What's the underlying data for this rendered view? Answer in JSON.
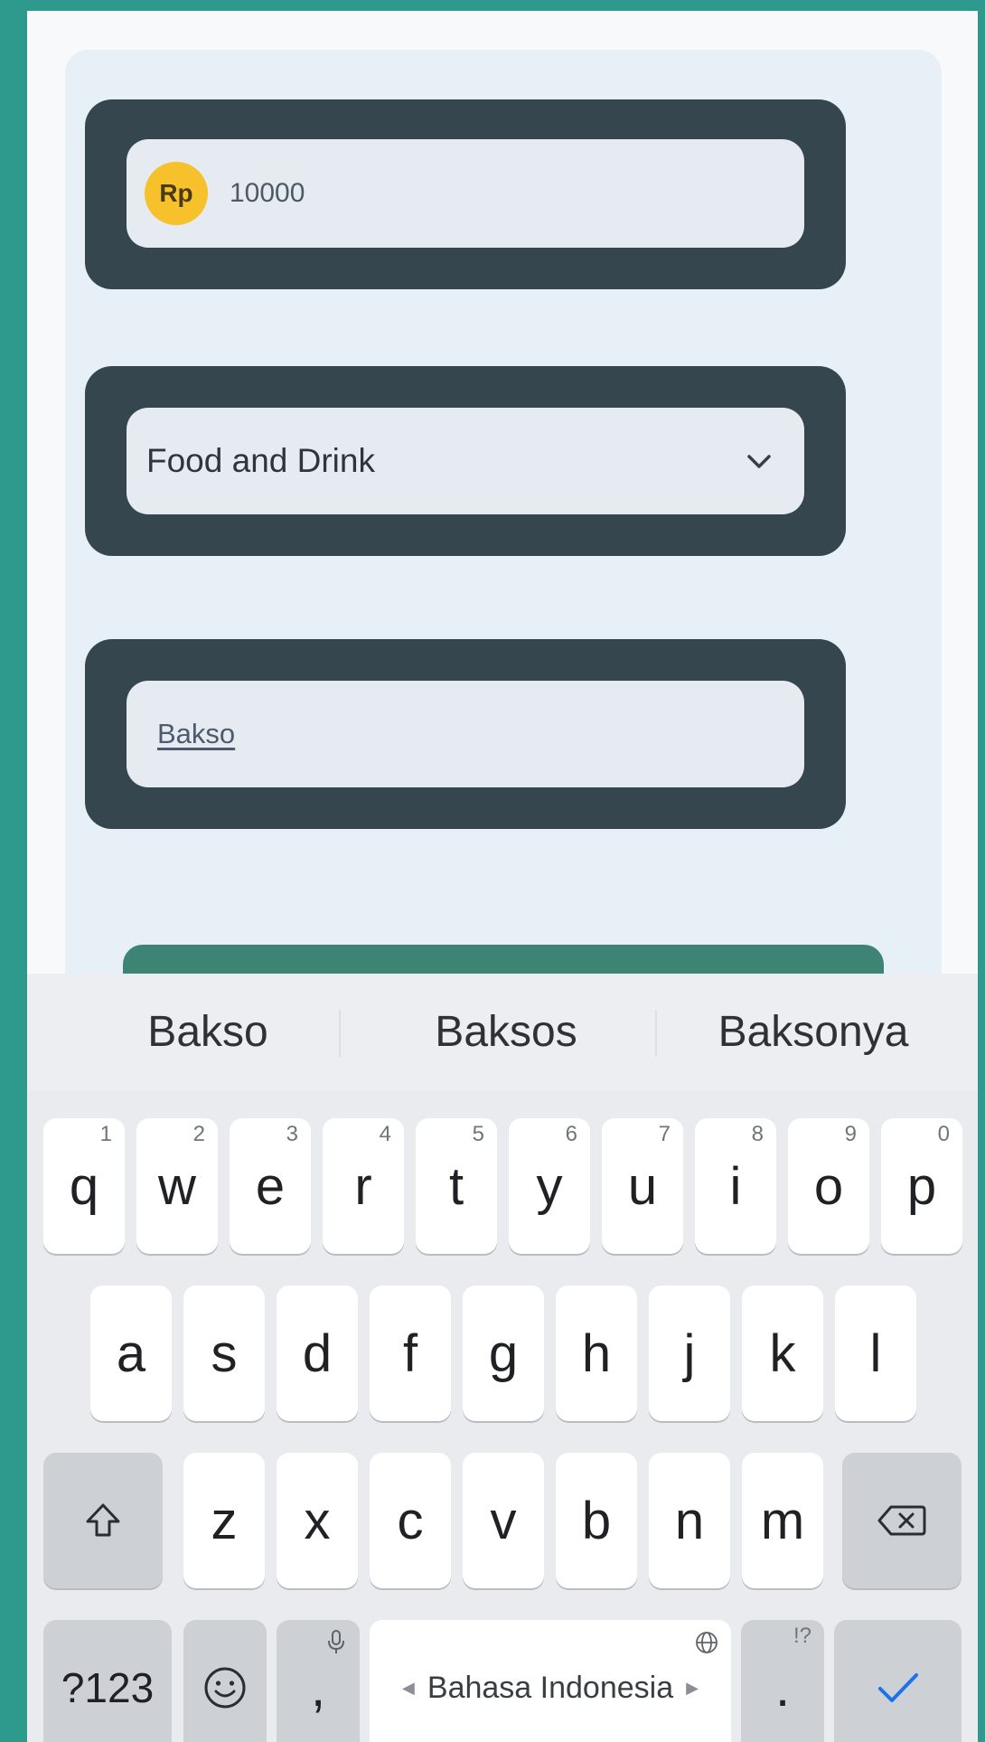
{
  "form": {
    "amount": {
      "currency_badge": "Rp",
      "value": "10000"
    },
    "category": {
      "selected": "Food and Drink"
    },
    "description": {
      "value": "Bakso"
    }
  },
  "keyboard": {
    "suggestions": [
      "Bakso",
      "Baksos",
      "Baksonya"
    ],
    "row1": [
      {
        "key": "q",
        "hint": "1"
      },
      {
        "key": "w",
        "hint": "2"
      },
      {
        "key": "e",
        "hint": "3"
      },
      {
        "key": "r",
        "hint": "4"
      },
      {
        "key": "t",
        "hint": "5"
      },
      {
        "key": "y",
        "hint": "6"
      },
      {
        "key": "u",
        "hint": "7"
      },
      {
        "key": "i",
        "hint": "8"
      },
      {
        "key": "o",
        "hint": "9"
      },
      {
        "key": "p",
        "hint": "0"
      }
    ],
    "row2": [
      "a",
      "s",
      "d",
      "f",
      "g",
      "h",
      "j",
      "k",
      "l"
    ],
    "row3": [
      "z",
      "x",
      "c",
      "v",
      "b",
      "n",
      "m"
    ],
    "symbols_label": "?123",
    "comma": ",",
    "period": ".",
    "period_hint": "!?",
    "spacebar_label": "Bahasa Indonesia",
    "icons": {
      "shift": "shift-icon",
      "backspace": "backspace-icon",
      "emoji": "emoji-icon",
      "mic": "mic-icon",
      "globe": "globe-icon",
      "enter": "checkmark-icon"
    }
  },
  "colors": {
    "frame": "#35464f",
    "field": "#e6ebf2",
    "badge": "#f7c12b",
    "save_button": "#3e8474",
    "accent": "#1a73e8"
  }
}
